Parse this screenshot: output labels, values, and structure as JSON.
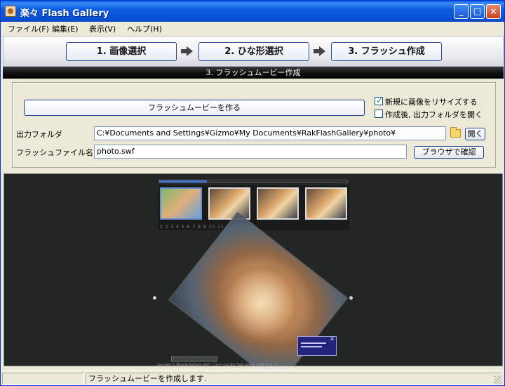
{
  "window": {
    "title": "楽々 Flash Gallery",
    "buttons": {
      "minimize": "_",
      "maximize": "□",
      "close": "×"
    }
  },
  "menu": {
    "items": [
      {
        "label": "ファイル(F)"
      },
      {
        "label": "編集(E)"
      },
      {
        "label": "表示(V)"
      },
      {
        "label": "ヘルプ(H)"
      }
    ]
  },
  "steps": [
    {
      "label": "1. 画像選択"
    },
    {
      "label": "2. ひな形選択"
    },
    {
      "label": "3. フラッシュ作成"
    }
  ],
  "section_title": "3. フラッシュムービー作成",
  "panel": {
    "create_button": "フラッシュムービーを作る",
    "resize_checkbox": {
      "label": "新規に画像をリサイズする",
      "checked": true
    },
    "open_folder_checkbox": {
      "label": "作成後, 出力フォルダを開く",
      "checked": false
    },
    "output_folder": {
      "label": "出力フォルダ",
      "value": "C:¥Documents and Settings¥Gizmo¥My Documents¥RakFlashGallery¥photo¥",
      "open_button": "開く"
    },
    "flash_file": {
      "label": "フラッシュファイル名",
      "value": "photo.swf",
      "browser_button": "ブラウザで確認"
    }
  },
  "preview": {
    "thumbnail_numbers": "1 2 3 4 5 6 7 8 9 10 11 12 13 14",
    "copyright": "Copyright (c) Wizardol Software 2007 - このページは 楽々 Flash Gallery で作成されました"
  },
  "status": {
    "message": "フラッシュムービーを作成します."
  },
  "colors": {
    "titlebar": "#0a5fe0",
    "preview_bg": "#222624",
    "section_bg": "#000000"
  }
}
